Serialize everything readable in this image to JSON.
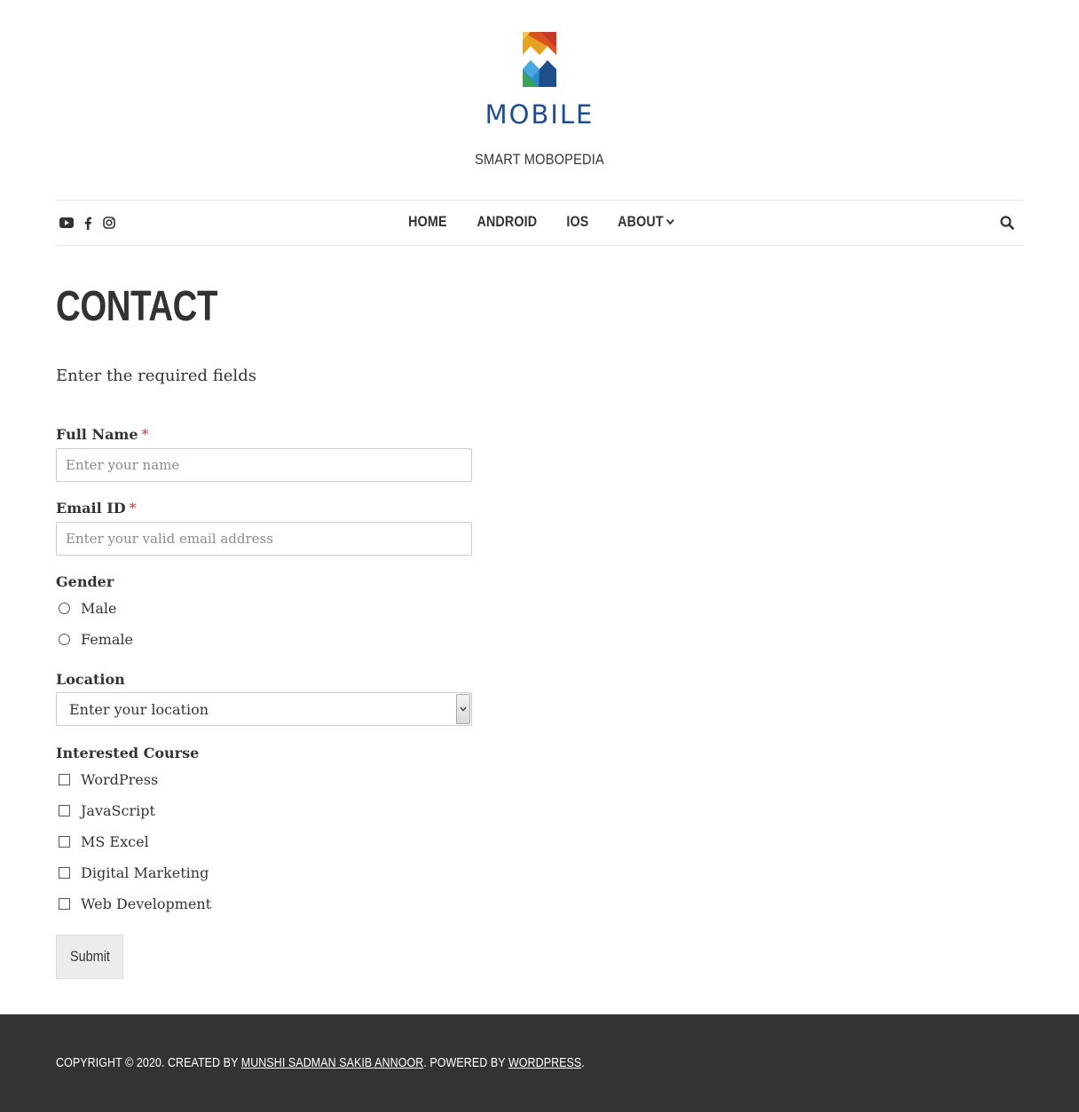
{
  "site": {
    "logo_text": "MOBILE",
    "tagline": "SMART MOBOPEDIA"
  },
  "nav": {
    "social_icons": [
      "youtube-icon",
      "facebook-icon",
      "instagram-icon"
    ],
    "items": [
      {
        "label": "HOME"
      },
      {
        "label": "ANDROID"
      },
      {
        "label": "IOS"
      },
      {
        "label": "ABOUT",
        "has_dropdown": true
      }
    ],
    "search_icon": "search-icon"
  },
  "page": {
    "title": "CONTACT",
    "intro": "Enter the required fields"
  },
  "form": {
    "full_name": {
      "label": "Full Name",
      "required_mark": "*",
      "placeholder": "Enter your name",
      "value": ""
    },
    "email": {
      "label": "Email ID",
      "required_mark": "*",
      "placeholder": "Enter your valid email address",
      "value": ""
    },
    "gender": {
      "label": "Gender",
      "options": [
        "Male",
        "Female"
      ],
      "selected": null
    },
    "location": {
      "label": "Location",
      "selected": "Enter your location"
    },
    "course": {
      "label": "Interested Course",
      "options": [
        "WordPress",
        "JavaScript",
        "MS Excel",
        "Digital Marketing",
        "Web Development"
      ],
      "checked": []
    },
    "submit_label": "Submit"
  },
  "footer": {
    "prefix": "COPYRIGHT © 2020. CREATED BY ",
    "author": "MUNSHI SADMAN SAKIB ANNOOR",
    "middle": ". POWERED BY ",
    "powered_by": "WORDPRESS",
    "suffix": "."
  },
  "colors": {
    "logo_blue": "#1f4e8c",
    "text": "#333333",
    "required": "#d63638",
    "footer_bg": "#333333",
    "border": "#e2e2e2"
  }
}
